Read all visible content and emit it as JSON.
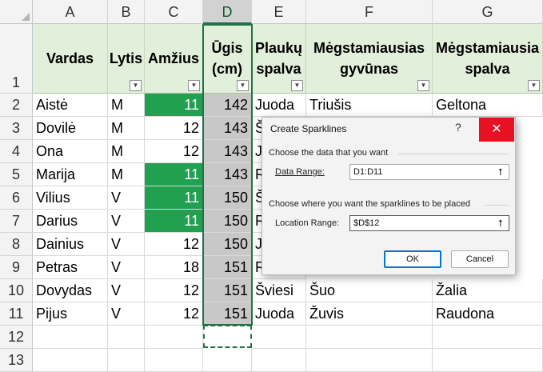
{
  "columns": [
    "A",
    "B",
    "C",
    "D",
    "E",
    "F",
    "G"
  ],
  "selected_column": "D",
  "row_numbers": [
    "1",
    "2",
    "3",
    "4",
    "5",
    "6",
    "7",
    "8",
    "9",
    "10",
    "11",
    "12",
    "13"
  ],
  "headers": {
    "A": "Vardas",
    "B": "Lytis",
    "C": "Amžius",
    "D_line1": "Ūgis",
    "D_line2": "(cm)",
    "E_line1": "Plaukų",
    "E_line2": "spalva",
    "F_line1": "Mėgstamiausias",
    "F_line2": "gyvūnas",
    "G_line1": "Mėgstamiausia",
    "G_line2": "spalva"
  },
  "filter_icon": "dropdown-arrow-icon",
  "rows": [
    {
      "A": "Aistė",
      "B": "M",
      "C": "11",
      "D": "142",
      "E": "Juoda",
      "F": "Triušis",
      "G": "Geltona"
    },
    {
      "A": "Dovilė",
      "B": "M",
      "C": "12",
      "D": "143",
      "E": "Š",
      "F": "",
      "G": ""
    },
    {
      "A": "Ona",
      "B": "M",
      "C": "12",
      "D": "143",
      "E": "Ju",
      "F": "",
      "G": ""
    },
    {
      "A": "Marija",
      "B": "M",
      "C": "11",
      "D": "143",
      "E": "R",
      "F": "",
      "G": ""
    },
    {
      "A": "Vilius",
      "B": "V",
      "C": "11",
      "D": "150",
      "E": "Š",
      "F": "",
      "G": ""
    },
    {
      "A": "Darius",
      "B": "V",
      "C": "11",
      "D": "150",
      "E": "R",
      "F": "",
      "G": ""
    },
    {
      "A": "Dainius",
      "B": "V",
      "C": "12",
      "D": "150",
      "E": "Ju",
      "F": "",
      "G": ""
    },
    {
      "A": "Petras",
      "B": "V",
      "C": "18",
      "D": "151",
      "E": "R",
      "F": "",
      "G": ""
    },
    {
      "A": "Dovydas",
      "B": "V",
      "C": "12",
      "D": "151",
      "E": "Šviesi",
      "F": "Šuo",
      "G": "Žalia"
    },
    {
      "A": "Pijus",
      "B": "V",
      "C": "12",
      "D": "151",
      "E": "Juoda",
      "F": "Žuvis",
      "G": "Raudona"
    }
  ],
  "colors": {
    "highlight_green": "#21a050",
    "selection_gray": "#c8c8c8",
    "header_fill": "#e2efda",
    "excel_green": "#217346",
    "close_red": "#e81123"
  },
  "dialog": {
    "title": "Create Sparklines",
    "help": "?",
    "close": "✕",
    "section1": "Choose the data that you want",
    "data_range_label": "Data Range:",
    "data_range_value": "D1:D11",
    "section2": "Choose where you want the sparklines to be placed",
    "location_range_label": "Location Range:",
    "location_range_value": "$D$12",
    "collapse_icon": "⭡",
    "ok": "OK",
    "cancel": "Cancel"
  }
}
